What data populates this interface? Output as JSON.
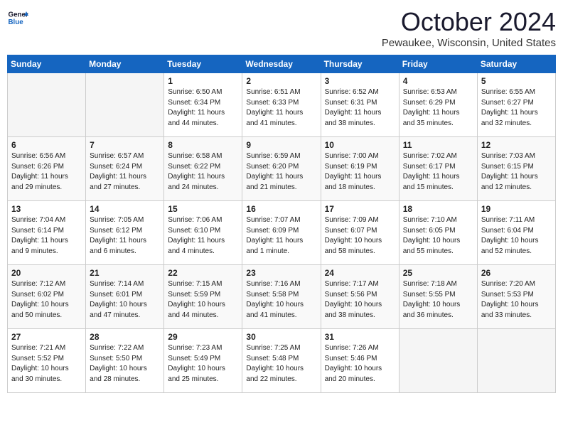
{
  "header": {
    "logo_line1": "General",
    "logo_line2": "Blue",
    "month_title": "October 2024",
    "location": "Pewaukee, Wisconsin, United States"
  },
  "weekdays": [
    "Sunday",
    "Monday",
    "Tuesday",
    "Wednesday",
    "Thursday",
    "Friday",
    "Saturday"
  ],
  "weeks": [
    [
      {
        "day": "",
        "info": ""
      },
      {
        "day": "",
        "info": ""
      },
      {
        "day": "1",
        "info": "Sunrise: 6:50 AM\nSunset: 6:34 PM\nDaylight: 11 hours\nand 44 minutes."
      },
      {
        "day": "2",
        "info": "Sunrise: 6:51 AM\nSunset: 6:33 PM\nDaylight: 11 hours\nand 41 minutes."
      },
      {
        "day": "3",
        "info": "Sunrise: 6:52 AM\nSunset: 6:31 PM\nDaylight: 11 hours\nand 38 minutes."
      },
      {
        "day": "4",
        "info": "Sunrise: 6:53 AM\nSunset: 6:29 PM\nDaylight: 11 hours\nand 35 minutes."
      },
      {
        "day": "5",
        "info": "Sunrise: 6:55 AM\nSunset: 6:27 PM\nDaylight: 11 hours\nand 32 minutes."
      }
    ],
    [
      {
        "day": "6",
        "info": "Sunrise: 6:56 AM\nSunset: 6:26 PM\nDaylight: 11 hours\nand 29 minutes."
      },
      {
        "day": "7",
        "info": "Sunrise: 6:57 AM\nSunset: 6:24 PM\nDaylight: 11 hours\nand 27 minutes."
      },
      {
        "day": "8",
        "info": "Sunrise: 6:58 AM\nSunset: 6:22 PM\nDaylight: 11 hours\nand 24 minutes."
      },
      {
        "day": "9",
        "info": "Sunrise: 6:59 AM\nSunset: 6:20 PM\nDaylight: 11 hours\nand 21 minutes."
      },
      {
        "day": "10",
        "info": "Sunrise: 7:00 AM\nSunset: 6:19 PM\nDaylight: 11 hours\nand 18 minutes."
      },
      {
        "day": "11",
        "info": "Sunrise: 7:02 AM\nSunset: 6:17 PM\nDaylight: 11 hours\nand 15 minutes."
      },
      {
        "day": "12",
        "info": "Sunrise: 7:03 AM\nSunset: 6:15 PM\nDaylight: 11 hours\nand 12 minutes."
      }
    ],
    [
      {
        "day": "13",
        "info": "Sunrise: 7:04 AM\nSunset: 6:14 PM\nDaylight: 11 hours\nand 9 minutes."
      },
      {
        "day": "14",
        "info": "Sunrise: 7:05 AM\nSunset: 6:12 PM\nDaylight: 11 hours\nand 6 minutes."
      },
      {
        "day": "15",
        "info": "Sunrise: 7:06 AM\nSunset: 6:10 PM\nDaylight: 11 hours\nand 4 minutes."
      },
      {
        "day": "16",
        "info": "Sunrise: 7:07 AM\nSunset: 6:09 PM\nDaylight: 11 hours\nand 1 minute."
      },
      {
        "day": "17",
        "info": "Sunrise: 7:09 AM\nSunset: 6:07 PM\nDaylight: 10 hours\nand 58 minutes."
      },
      {
        "day": "18",
        "info": "Sunrise: 7:10 AM\nSunset: 6:05 PM\nDaylight: 10 hours\nand 55 minutes."
      },
      {
        "day": "19",
        "info": "Sunrise: 7:11 AM\nSunset: 6:04 PM\nDaylight: 10 hours\nand 52 minutes."
      }
    ],
    [
      {
        "day": "20",
        "info": "Sunrise: 7:12 AM\nSunset: 6:02 PM\nDaylight: 10 hours\nand 50 minutes."
      },
      {
        "day": "21",
        "info": "Sunrise: 7:14 AM\nSunset: 6:01 PM\nDaylight: 10 hours\nand 47 minutes."
      },
      {
        "day": "22",
        "info": "Sunrise: 7:15 AM\nSunset: 5:59 PM\nDaylight: 10 hours\nand 44 minutes."
      },
      {
        "day": "23",
        "info": "Sunrise: 7:16 AM\nSunset: 5:58 PM\nDaylight: 10 hours\nand 41 minutes."
      },
      {
        "day": "24",
        "info": "Sunrise: 7:17 AM\nSunset: 5:56 PM\nDaylight: 10 hours\nand 38 minutes."
      },
      {
        "day": "25",
        "info": "Sunrise: 7:18 AM\nSunset: 5:55 PM\nDaylight: 10 hours\nand 36 minutes."
      },
      {
        "day": "26",
        "info": "Sunrise: 7:20 AM\nSunset: 5:53 PM\nDaylight: 10 hours\nand 33 minutes."
      }
    ],
    [
      {
        "day": "27",
        "info": "Sunrise: 7:21 AM\nSunset: 5:52 PM\nDaylight: 10 hours\nand 30 minutes."
      },
      {
        "day": "28",
        "info": "Sunrise: 7:22 AM\nSunset: 5:50 PM\nDaylight: 10 hours\nand 28 minutes."
      },
      {
        "day": "29",
        "info": "Sunrise: 7:23 AM\nSunset: 5:49 PM\nDaylight: 10 hours\nand 25 minutes."
      },
      {
        "day": "30",
        "info": "Sunrise: 7:25 AM\nSunset: 5:48 PM\nDaylight: 10 hours\nand 22 minutes."
      },
      {
        "day": "31",
        "info": "Sunrise: 7:26 AM\nSunset: 5:46 PM\nDaylight: 10 hours\nand 20 minutes."
      },
      {
        "day": "",
        "info": ""
      },
      {
        "day": "",
        "info": ""
      }
    ]
  ]
}
